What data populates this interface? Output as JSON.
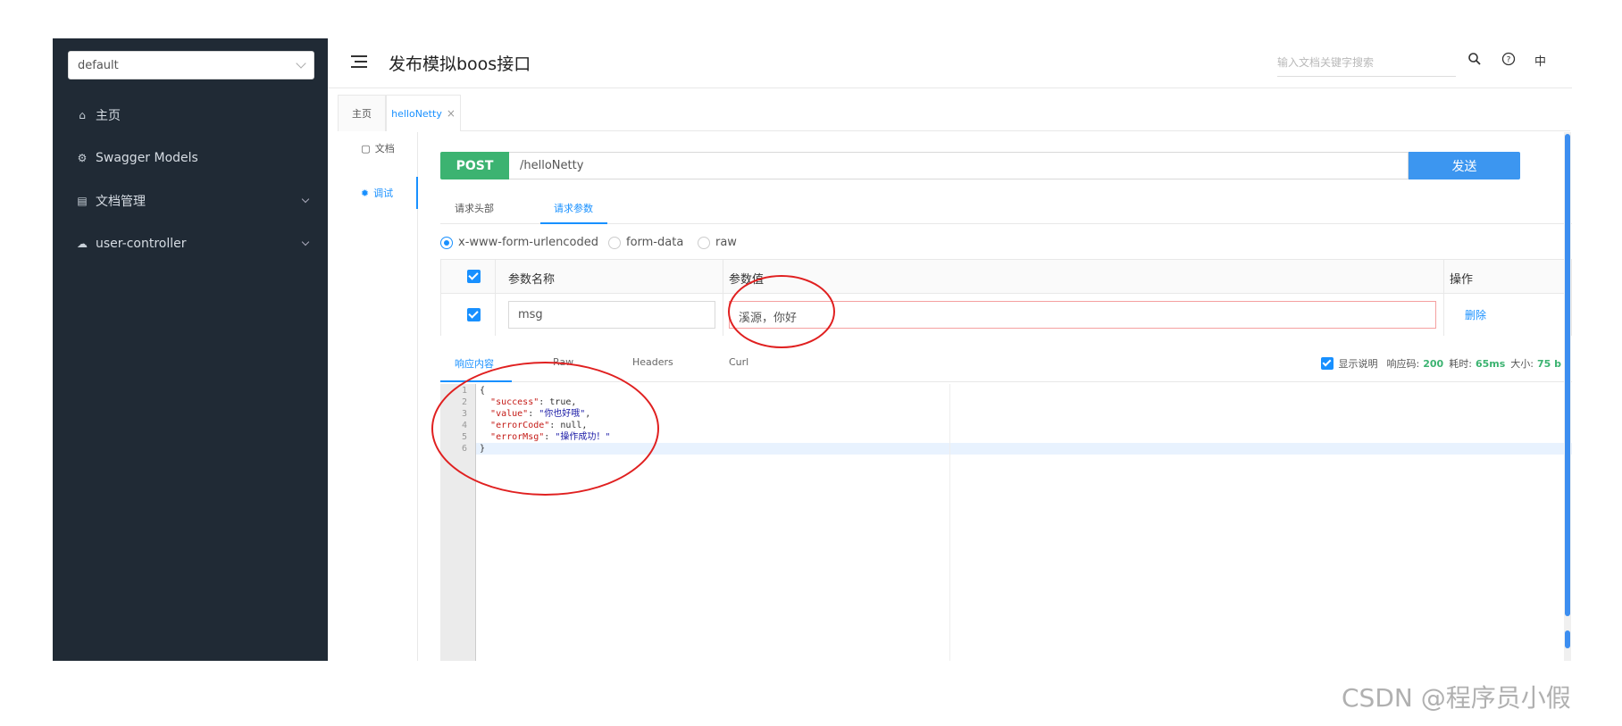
{
  "sidebar": {
    "group_select": "default",
    "items": [
      {
        "label": "主页",
        "icon": "home-icon",
        "glyph": "⌂",
        "has_arrow": false
      },
      {
        "label": "Swagger Models",
        "icon": "models-icon",
        "glyph": "⚙",
        "has_arrow": false
      },
      {
        "label": "文档管理",
        "icon": "docs-icon",
        "glyph": "▤",
        "has_arrow": true
      },
      {
        "label": "user-controller",
        "icon": "cloud-icon",
        "glyph": "☁",
        "has_arrow": true
      }
    ]
  },
  "header": {
    "title": "发布模拟boos接口",
    "search_placeholder": "输入文档关键字搜索",
    "lang": "中"
  },
  "tabs": [
    {
      "label": "主页",
      "active": false
    },
    {
      "label": "helloNetty",
      "active": true,
      "closable": true,
      "close_glyph": "×"
    }
  ],
  "subnav": [
    {
      "label": "文档",
      "icon": "document-icon",
      "glyph": "▢"
    },
    {
      "label": "调试",
      "icon": "debug-icon",
      "glyph": "✹"
    }
  ],
  "request": {
    "method": "POST",
    "url": "/helloNetty",
    "send_label": "发送",
    "tabs": [
      "请求头部",
      "请求参数"
    ],
    "active_tab": "请求参数",
    "content_types": [
      "x-www-form-urlencoded",
      "form-data",
      "raw"
    ],
    "selected_content_type": "x-www-form-urlencoded"
  },
  "params": {
    "headers": {
      "name": "参数名称",
      "value": "参数值",
      "op": "操作"
    },
    "rows": [
      {
        "checked": true,
        "name": "msg",
        "value": "溪源，你好",
        "action": "删除"
      }
    ]
  },
  "response": {
    "tabs": [
      "响应内容",
      "Raw",
      "Headers",
      "Curl"
    ],
    "active_tab": "响应内容",
    "show_desc_label": "显示说明",
    "status_label": "响应码:",
    "status": "200",
    "time_label": "耗时:",
    "time": "65ms",
    "size_label": "大小:",
    "size": "75 b",
    "code_lines": [
      {
        "n": "1",
        "pre": "{"
      },
      {
        "n": "2",
        "key": "\"success\"",
        "sep": ": ",
        "val": "true,"
      },
      {
        "n": "3",
        "key": "\"value\"",
        "sep": ": ",
        "str": "\"你也好哦\"",
        "tail": ","
      },
      {
        "n": "4",
        "key": "\"errorCode\"",
        "sep": ": ",
        "val": "null,"
      },
      {
        "n": "5",
        "key": "\"errorMsg\"",
        "sep": ": ",
        "str": "\"操作成功！\""
      },
      {
        "n": "6",
        "pre": "}"
      }
    ]
  },
  "watermark": "CSDN @程序员小假",
  "colors": {
    "accent": "#1890ff",
    "post": "#3cb371",
    "sidebar": "#202a35",
    "annotation": "#e02020"
  }
}
